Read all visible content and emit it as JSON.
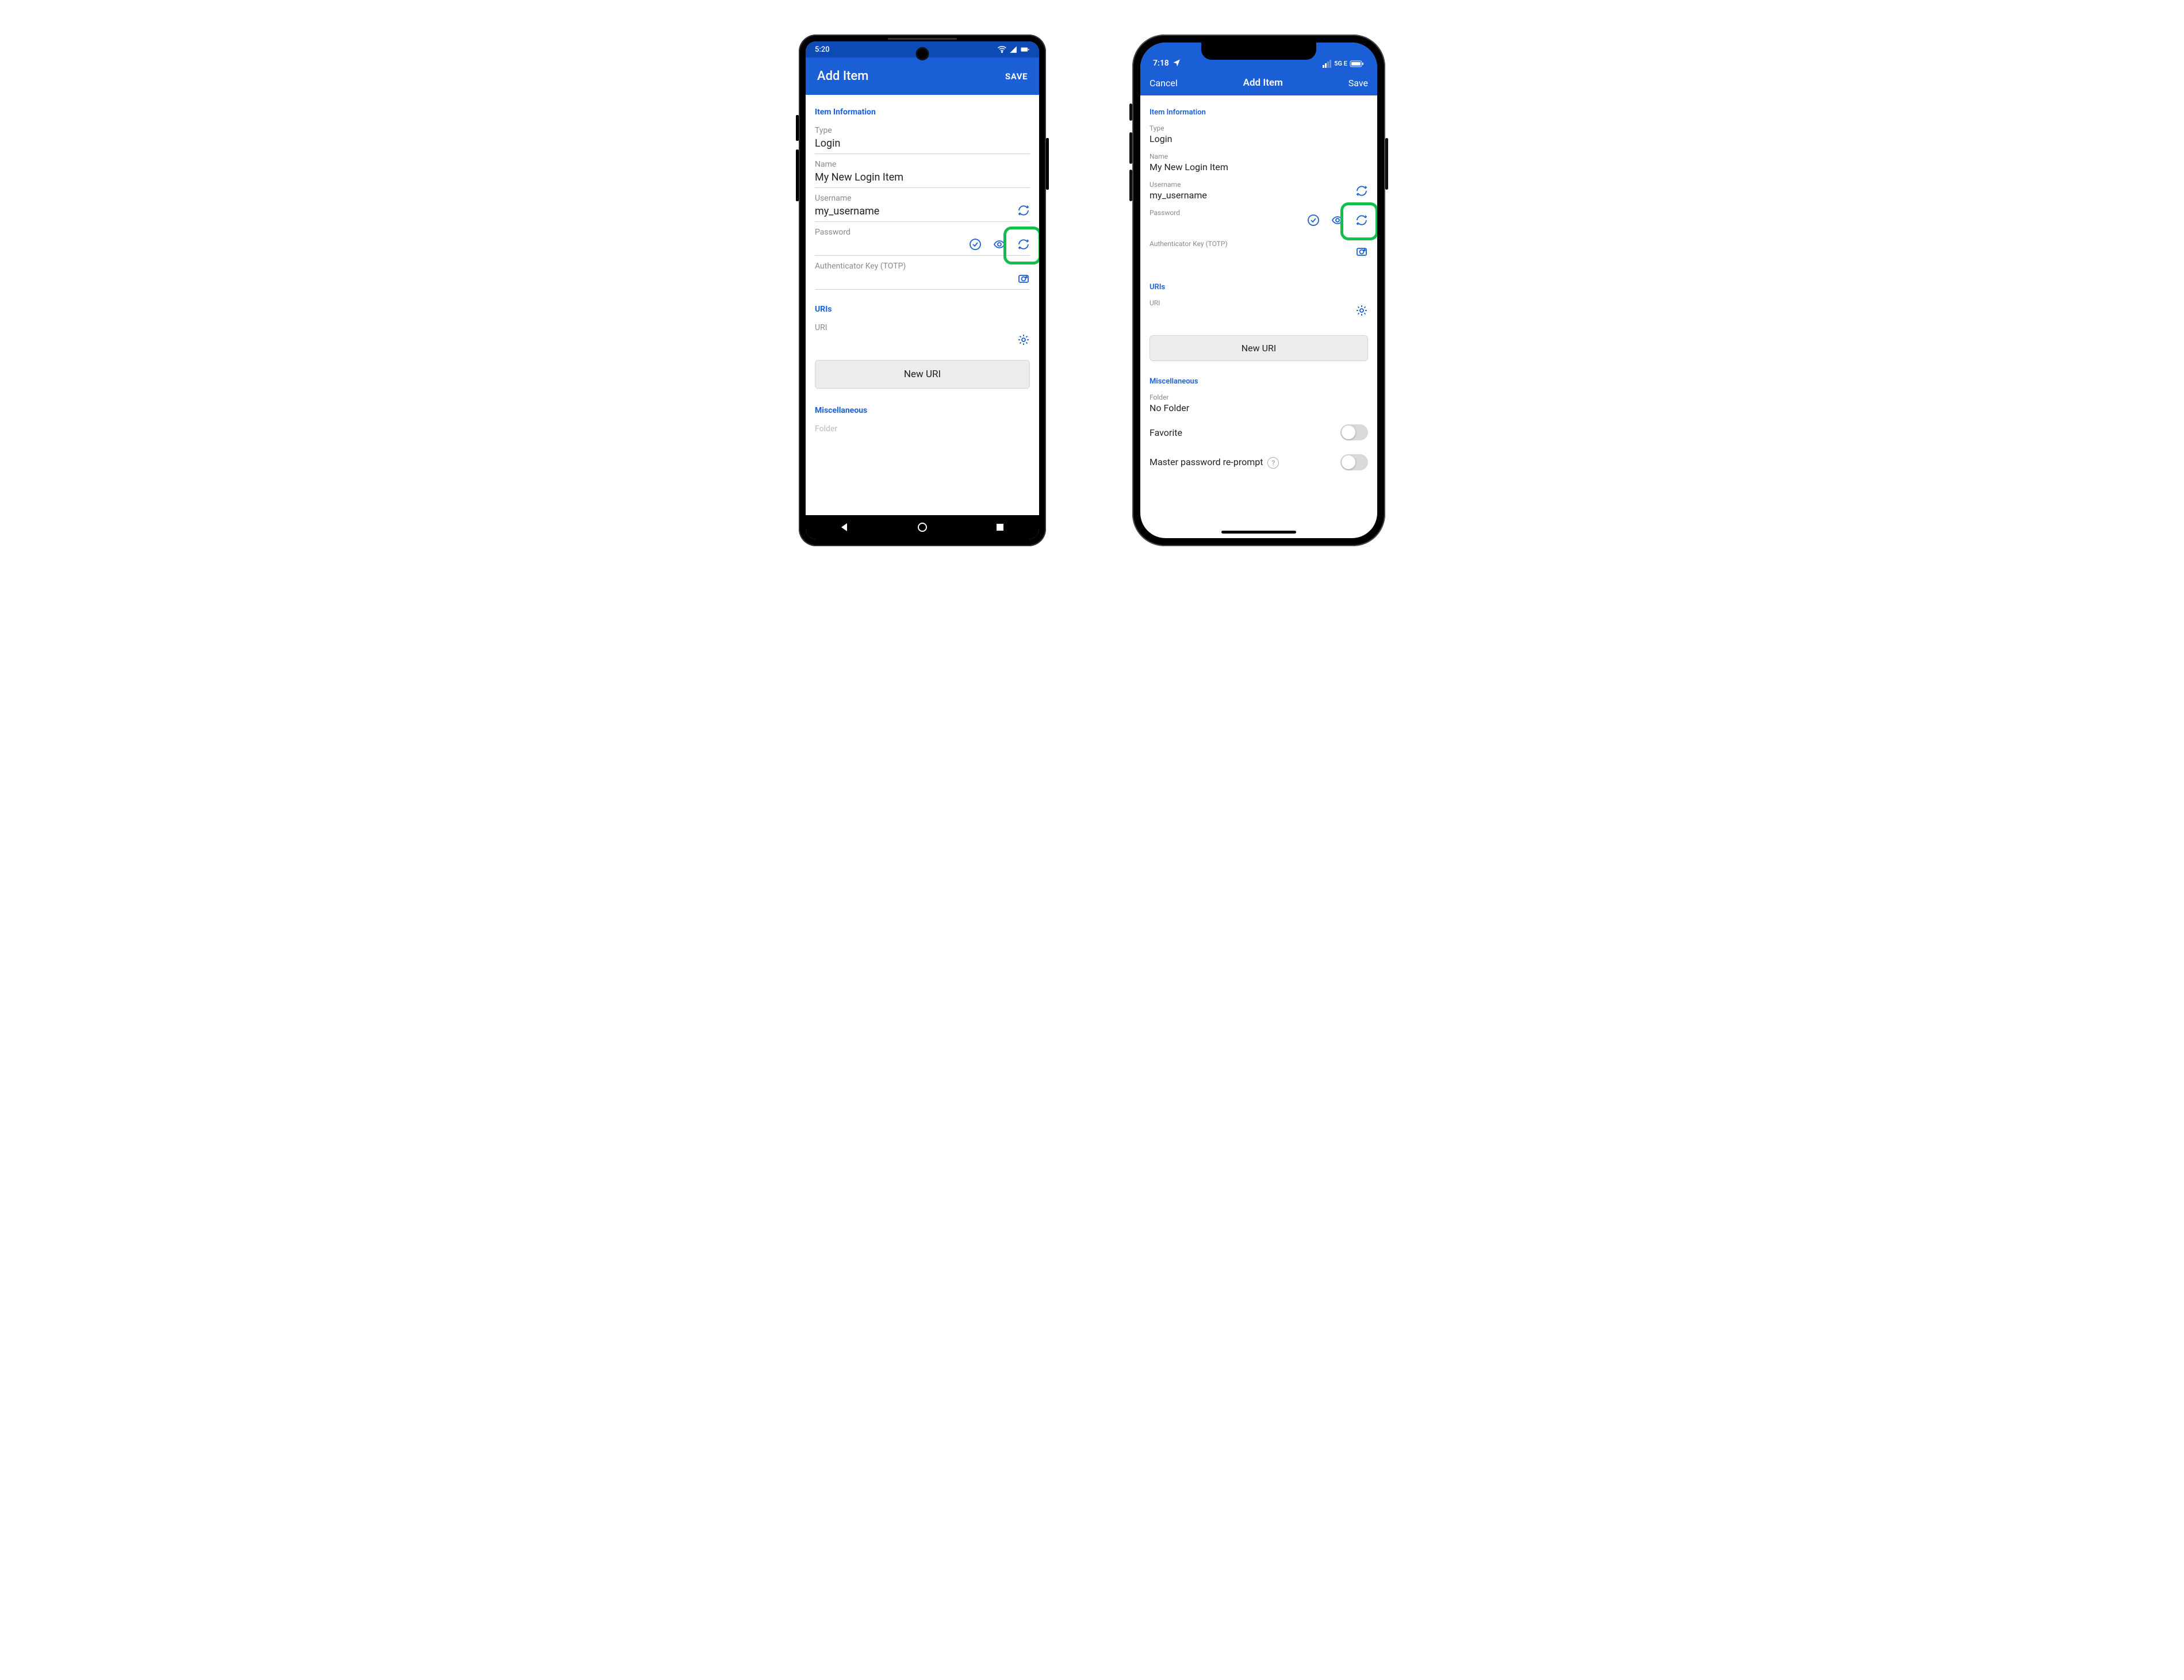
{
  "colors": {
    "brand": "#1a5fd6",
    "highlight": "#11c04b"
  },
  "android": {
    "status": {
      "time": "5:20",
      "wifi": true,
      "signal": true,
      "battery": true
    },
    "titlebar": {
      "title": "Add Item",
      "save": "SAVE"
    },
    "sections": {
      "item_info": "Item Information",
      "uris": "URIs",
      "misc": "Miscellaneous"
    },
    "fields": {
      "type": {
        "label": "Type",
        "value": "Login"
      },
      "name": {
        "label": "Name",
        "value": "My New Login Item"
      },
      "username": {
        "label": "Username",
        "value": "my_username"
      },
      "password": {
        "label": "Password",
        "value": ""
      },
      "totp": {
        "label": "Authenticator Key (TOTP)",
        "value": ""
      },
      "uri": {
        "label": "URI",
        "value": ""
      },
      "folder": {
        "label": "Folder",
        "value": ""
      }
    },
    "buttons": {
      "new_uri": "New URI"
    }
  },
  "ios": {
    "status": {
      "time": "7:18",
      "network_label": "5G E",
      "signal_bars": 2,
      "battery": true,
      "location": true
    },
    "titlebar": {
      "cancel": "Cancel",
      "title": "Add Item",
      "save": "Save"
    },
    "sections": {
      "item_info": "Item Information",
      "uris": "URIs",
      "misc": "Miscellaneous"
    },
    "fields": {
      "type": {
        "label": "Type",
        "value": "Login"
      },
      "name": {
        "label": "Name",
        "value": "My New Login Item"
      },
      "username": {
        "label": "Username",
        "value": "my_username"
      },
      "password": {
        "label": "Password",
        "value": ""
      },
      "totp": {
        "label": "Authenticator Key (TOTP)",
        "value": ""
      },
      "uri": {
        "label": "URI",
        "value": ""
      },
      "folder": {
        "label": "Folder",
        "value": "No Folder"
      }
    },
    "toggles": {
      "favorite": {
        "label": "Favorite",
        "on": false
      },
      "reprompt": {
        "label": "Master password re-prompt",
        "on": false
      }
    },
    "buttons": {
      "new_uri": "New URI"
    }
  }
}
